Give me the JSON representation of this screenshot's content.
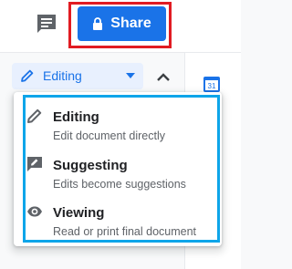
{
  "header": {
    "share_label": "Share"
  },
  "toolbar": {
    "mode_label": "Editing"
  },
  "calendar": {
    "day": "31"
  },
  "mode_menu": {
    "items": [
      {
        "title": "Editing",
        "description": "Edit document directly"
      },
      {
        "title": "Suggesting",
        "description": "Edits become suggestions"
      },
      {
        "title": "Viewing",
        "description": "Read or print final document"
      }
    ]
  },
  "colors": {
    "accent": "#1a73e8",
    "share_highlight": "#e11b22",
    "menu_highlight": "#0ea5e9"
  }
}
